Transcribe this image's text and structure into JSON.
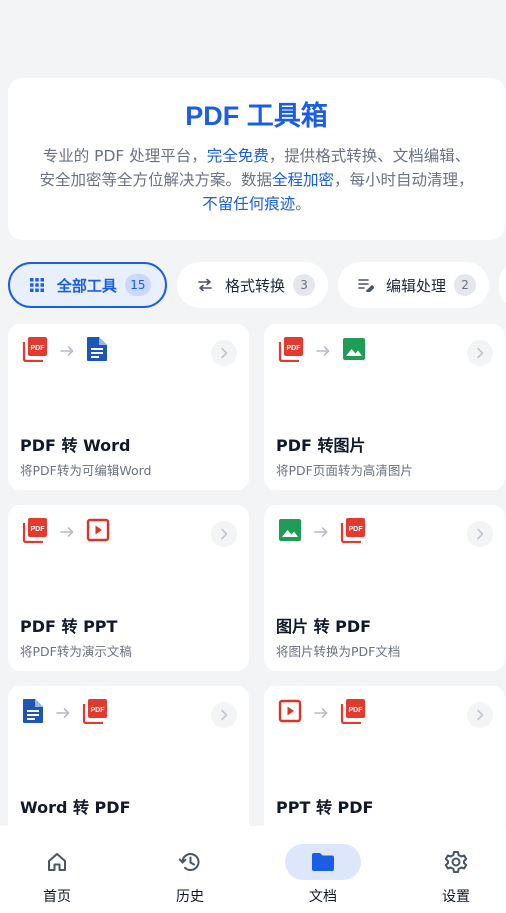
{
  "hero": {
    "title": "PDF 工具箱",
    "desc_1": "专业的 PDF 处理平台，",
    "desc_hl_1": "完全免费",
    "desc_2": "，提供格式转换、文档编辑、安全加密等全方位解决方案。数据",
    "desc_hl_2": "全程加密",
    "desc_3": "，每小时自动清理，",
    "desc_hl_3": "不留任何痕迹",
    "desc_4": "。"
  },
  "filters": [
    {
      "label": "全部工具",
      "count": "15",
      "icon": "grid-icon",
      "active": true
    },
    {
      "label": "格式转换",
      "count": "3",
      "icon": "swap-icon",
      "active": false
    },
    {
      "label": "编辑处理",
      "count": "2",
      "icon": "edit-list-icon",
      "active": false
    }
  ],
  "tools": [
    {
      "title": "PDF 转 Word",
      "desc": "将PDF转为可编辑Word",
      "from_icon": "pdf-icon",
      "to_icon": "doc-icon"
    },
    {
      "title": "PDF 转图片",
      "desc": "将PDF页面转为高清图片",
      "from_icon": "pdf-icon",
      "to_icon": "image-icon"
    },
    {
      "title": "PDF 转 PPT",
      "desc": "将PDF转为演示文稿",
      "from_icon": "pdf-icon",
      "to_icon": "slides-icon"
    },
    {
      "title": "图片 转 PDF",
      "desc": "将图片转换为PDF文档",
      "from_icon": "image-icon",
      "to_icon": "pdf-icon"
    },
    {
      "title": "Word 转 PDF",
      "desc": "",
      "from_icon": "doc-icon",
      "to_icon": "pdf-icon"
    },
    {
      "title": "PPT 转 PDF",
      "desc": "",
      "from_icon": "slides-icon",
      "to_icon": "pdf-icon"
    }
  ],
  "nav": [
    {
      "label": "首页",
      "icon": "home-icon",
      "active": false
    },
    {
      "label": "历史",
      "icon": "history-icon",
      "active": false
    },
    {
      "label": "文档",
      "icon": "folder-icon",
      "active": true
    },
    {
      "label": "设置",
      "icon": "gear-icon",
      "active": false
    }
  ],
  "colors": {
    "accent": "#1a5ee6",
    "pdf_red": "#e23b2e",
    "doc_blue": "#1e56b8",
    "image_green": "#1f9d55",
    "slides_red": "#d9352a"
  }
}
